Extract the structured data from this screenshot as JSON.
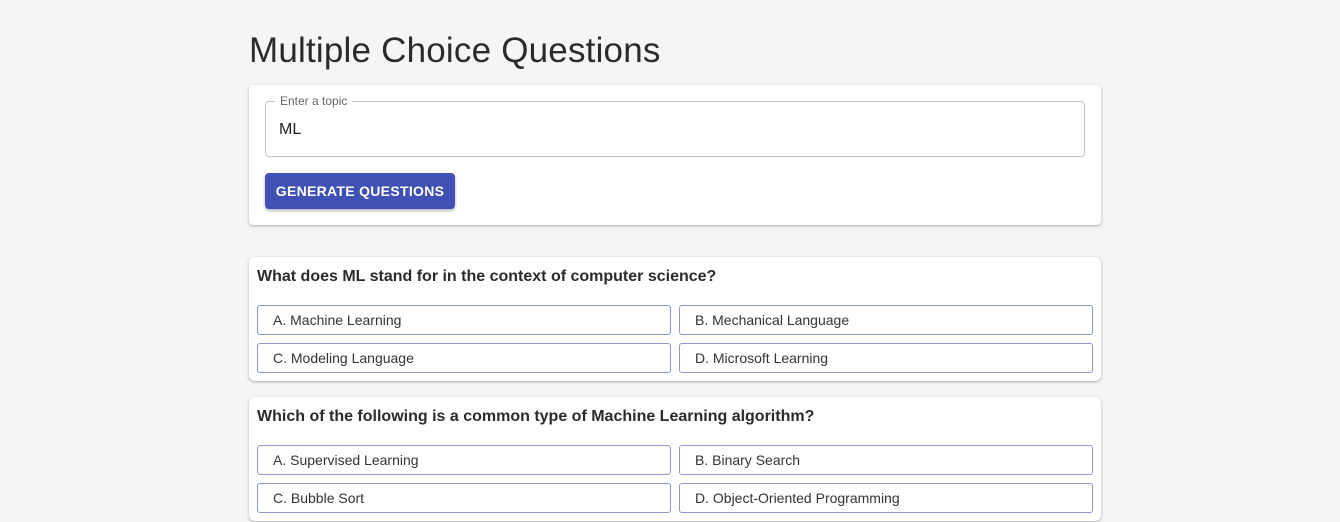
{
  "page": {
    "title": "Multiple Choice Questions"
  },
  "topic_form": {
    "label": "Enter a topic",
    "value": "ML",
    "button_label": "GENERATE QUESTIONS"
  },
  "questions": [
    {
      "text": "What does ML stand for in the context of computer science?",
      "options": [
        "A. Machine Learning",
        "B. Mechanical Language",
        "C. Modeling Language",
        "D. Microsoft Learning"
      ]
    },
    {
      "text": "Which of the following is a common type of Machine Learning algorithm?",
      "options": [
        "A. Supervised Learning",
        "B. Binary Search",
        "C. Bubble Sort",
        "D. Object-Oriented Programming"
      ]
    }
  ],
  "colors": {
    "background": "#f5f5f5",
    "primary": "#3f51b5",
    "option_border": "#8e99c9"
  }
}
